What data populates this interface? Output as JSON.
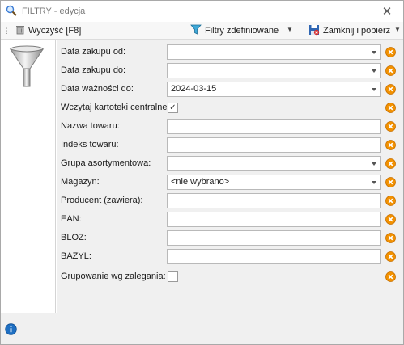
{
  "window": {
    "title": "FILTRY - edycja",
    "close_glyph": "✕"
  },
  "toolbar": {
    "clear_label": "Wyczyść [F8]",
    "filters_label": "Filtry zdefiniowane",
    "close_label": "Zamknij i pobierz",
    "dropdown_glyph": "▼"
  },
  "form": {
    "purchase_date_from": {
      "label": "Data zakupu od:",
      "value": ""
    },
    "purchase_date_to": {
      "label": "Data zakupu do:",
      "value": ""
    },
    "expiry_date_to": {
      "label": "Data ważności do:",
      "value": "2024-03-15"
    },
    "load_central_cards": {
      "label": "Wczytaj kartoteki centralne:",
      "checked": true,
      "check_glyph": "✓"
    },
    "product_name": {
      "label": "Nazwa towaru:",
      "value": ""
    },
    "product_index": {
      "label": "Indeks towaru:",
      "value": ""
    },
    "assortment_group": {
      "label": "Grupa asortymentowa:",
      "value": ""
    },
    "warehouse": {
      "label": "Magazyn:",
      "value": "<nie wybrano>"
    },
    "producer": {
      "label": "Producent (zawiera):",
      "value": ""
    },
    "ean": {
      "label": "EAN:",
      "value": ""
    },
    "bloz": {
      "label": "BLOZ:",
      "value": ""
    },
    "bazyl": {
      "label": "BAZYL:",
      "value": ""
    },
    "group_by_stock": {
      "label": "Grupowanie wg zalegania:",
      "checked": false,
      "check_glyph": ""
    }
  },
  "icons": {
    "window": "search-icon",
    "clear": "trash-icon",
    "filters": "funnel-icon",
    "close": "save-close-icon",
    "side": "funnel-icon",
    "clear_field": "clear-x-icon",
    "info": "info-icon"
  },
  "colors": {
    "clear_badge": "#f29100",
    "info": "#1e6fc2",
    "form_bg": "#f0f0f0"
  }
}
